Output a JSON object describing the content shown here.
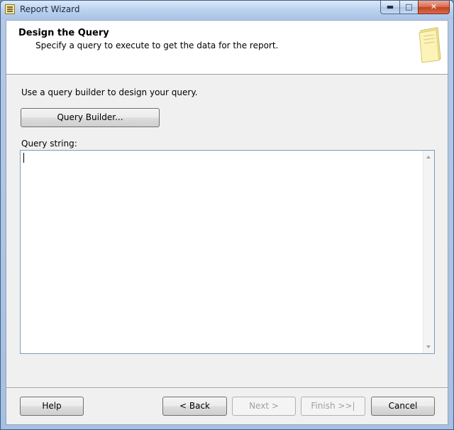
{
  "window": {
    "title": "Report Wizard",
    "controls": {
      "minimize": "▬",
      "maximize": "□",
      "close": "✕"
    }
  },
  "header": {
    "title": "Design the Query",
    "subtitle": "Specify a query to execute to get the data for the report.",
    "icon": "wizard-page-icon"
  },
  "body": {
    "instruction": "Use a query builder to design your query.",
    "query_builder_label": "Query Builder...",
    "query_string_label": "Query string:",
    "query_string_value": ""
  },
  "footer": {
    "help_label": "Help",
    "back_label": "< Back",
    "next_label": "Next >",
    "finish_label": "Finish >>|",
    "cancel_label": "Cancel"
  },
  "colors": {
    "titlebar": "#bcd2ef",
    "client_bg": "#f0f0f0",
    "close_button": "#d96e53"
  }
}
